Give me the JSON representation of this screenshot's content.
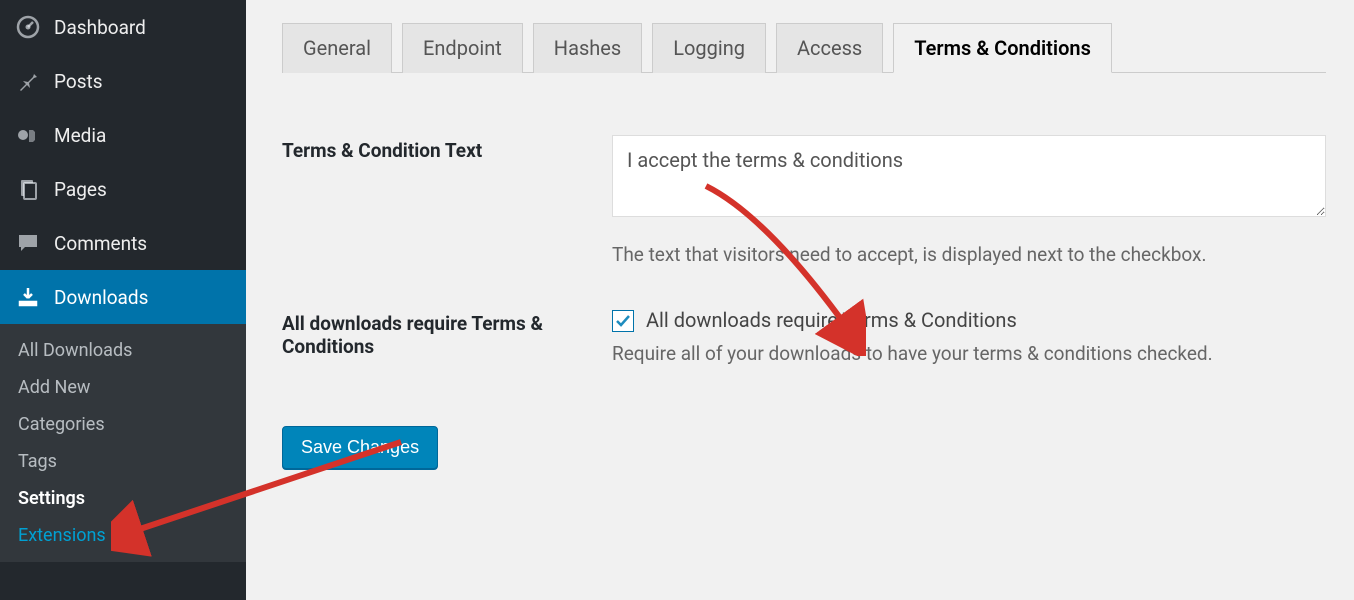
{
  "sidebar": {
    "items": [
      {
        "label": "Dashboard",
        "icon": "dashboard"
      },
      {
        "label": "Posts",
        "icon": "pin"
      },
      {
        "label": "Media",
        "icon": "media"
      },
      {
        "label": "Pages",
        "icon": "pages"
      },
      {
        "label": "Comments",
        "icon": "comment"
      },
      {
        "label": "Downloads",
        "icon": "download"
      }
    ],
    "submenu": [
      {
        "label": "All Downloads"
      },
      {
        "label": "Add New"
      },
      {
        "label": "Categories"
      },
      {
        "label": "Tags"
      },
      {
        "label": "Settings"
      },
      {
        "label": "Extensions"
      }
    ]
  },
  "tabs": [
    {
      "label": "General"
    },
    {
      "label": "Endpoint"
    },
    {
      "label": "Hashes"
    },
    {
      "label": "Logging"
    },
    {
      "label": "Access"
    },
    {
      "label": "Terms & Conditions"
    }
  ],
  "form": {
    "terms_text_label": "Terms & Condition Text",
    "terms_text_value": "I accept the terms & conditions",
    "terms_text_description": "The text that visitors need to accept, is displayed next to the checkbox.",
    "require_label": "All downloads require Terms & Conditions",
    "require_checkbox_label": "All downloads require Terms & Conditions",
    "require_description": "Require all of your downloads to have your terms & conditions checked.",
    "save_button": "Save Changes"
  }
}
